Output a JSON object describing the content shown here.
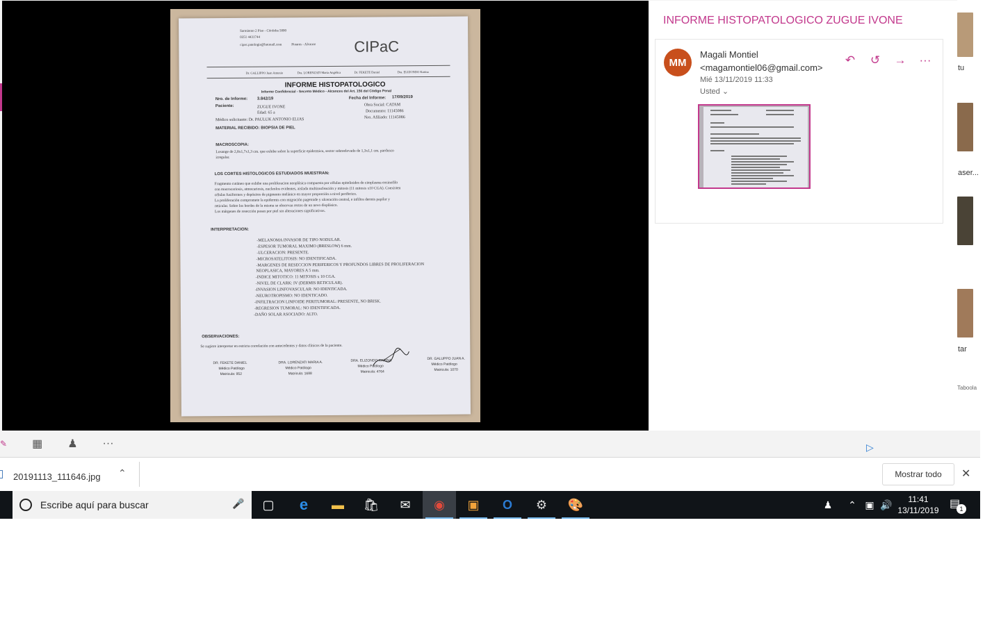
{
  "mail": {
    "subject": "INFORME HISTOPATOLOGICO ZUGUE IVONE",
    "avatar_initials": "MM",
    "sender": "Magali Montiel <magamontiel06@gmail.com>",
    "date": "Mié 13/11/2019 11:33",
    "to": "Usted",
    "actions": [
      "reply",
      "reply-all",
      "forward",
      "more"
    ]
  },
  "background": {
    "side_texts": [
      "tu",
      "aser...",
      "tar"
    ],
    "taboola": "Taboola"
  },
  "document": {
    "header": [
      "Sarmiento 2 Piso - Córdoba 5000",
      "0351 4431744",
      "cipac.patologia@hotmail.com",
      "Pinares - Alcance"
    ],
    "logo": "CIPaC",
    "doctors_line": [
      "Dr. GALLIPPO Juan Antonio",
      "Dra. LORENZATI María Angélica",
      "Dr. FEKETE Daniel",
      "Dra. ELIZONDO Karina"
    ],
    "title": "INFORME HISTOPATOLOGICO",
    "confidential": "Informe Confidencial - Secreto Médico - Alcances del Art. 156 del Código Penal",
    "nro_label": "Nro. de Informe:",
    "nro_value": "3.842/19",
    "fecha_label": "Fecha del Informe:",
    "fecha_value": "17/09/2019",
    "paciente_label": "Paciente:",
    "paciente_value": "ZUGUE IVONE",
    "edad": "Edad: 65 a",
    "obra_social": "Obra Social: CATAM",
    "documento": "Documento: 11145086",
    "medico": "Médico solicitante: Dr. PAULUK ANTONIO ELIAS",
    "afiliado": "Nro. Afiliado: 11145086",
    "material": "MATERIAL RECIBIDO: BIOPSIA DE PIEL",
    "macroscopia_label": "MACROSCOPIA:",
    "macroscopia": [
      "Losange de 2,8x1,7x1,3 cm. que exhibe sobre la superficie epidermica, sector sobreelevado de 1,3x1,1 cm. pardusco",
      "irregular."
    ],
    "cortes_label": "LOS CORTES HISTOLOGICOS ESTUDIADOS MUESTRAN:",
    "cortes": [
      "Fragmento cutáneo que exhibe una proliferacion neoplásica compuesta por células epitelioides de citoplasma eosinofilo",
      "con macrocariosis, atmocariosis, nucleolos evidentes, aislada multinucleación y mitosis (11 mitosis x10 CGA). Coexisten",
      "células fusiformes y depósitos de pigmento melánico en mayor proporción a nivel periferico.",
      "La proliferación compromete la epidermis con migración pagetoide y ulceración central, e infiltra dermis papilar y",
      "reticular. Sobre los bordes de la misma se observan restos de un nevo displásico.",
      "Los márgenes de resección pasan por piel sin alteraciones significativas."
    ],
    "interp_label": "INTERPRETACION:",
    "interp": [
      "-MELANOMA INVASOR DE TIPO NODULAR.",
      "-ESPESOR TUMORAL MAXIMO (BRESLOW) 6 mm.",
      "-ULCERACION: PRESENTE.",
      "-MICROSATELITOSIS: NO IDENTIFICADA.",
      "-MARGENES DE RESECCION PERIFERICOS Y PROFUNDOS LIBRES DE PROLIFERACION",
      "NEOPLASICA, MAYORES A 5 mm.",
      "-INDICE MITOTICO: 11 MITOSIS x 10 CGA.",
      "-NIVEL DE CLARK: IV (DERMIS RETICULAR).",
      "-INVASION LINFOVASCULAR: NO IDENTICADA.",
      "-NEUROTROPISMO: NO IDENTICADO.",
      "-INFILTRACION LINFOIDE PERITUMORAL: PRESENTE, NO BRISK.",
      "-REGRESION TUMORAL: NO IDENTIFICADA.",
      "-DAÑO SOLAR ASOCIADO: ALTO."
    ],
    "obs_label": "OBSERVACIONES:",
    "obs": "Se sugiere interpretar en estricta correlación con antecedentes y datos clínicos de la paciente.",
    "signatures": [
      {
        "name": "DR. FEKETE DANIEL",
        "role": "Médico Patólogo",
        "mat": "Matricula: 952"
      },
      {
        "name": "DRA. LORENZATI MARIA A.",
        "role": "Médico Patólogo",
        "mat": "Matricula: 1688"
      },
      {
        "name": "DRA. ELIZONDO KARINA",
        "role": "Médico Patólogo",
        "mat": "Matricula: 4764"
      },
      {
        "name": "DR. GALUPPO JUAN A.",
        "role": "Médico Patólogo",
        "mat": "Matricula: 1070"
      }
    ]
  },
  "downloads": {
    "file": "20191113_111646.jpg",
    "show_all": "Mostrar todo"
  },
  "taskbar": {
    "search_placeholder": "Escribe aquí para buscar",
    "time": "11:41",
    "date": "13/11/2019",
    "notifications": "1"
  }
}
